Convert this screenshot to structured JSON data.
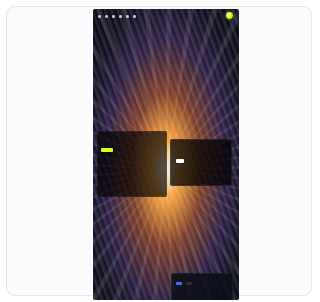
{
  "app": {
    "name": "",
    "accent_color": "#d7ff1a"
  },
  "topbar": {
    "nav_dots_count": 6,
    "brand_text": ""
  },
  "hero": {
    "title": "",
    "copy": "",
    "cta_label": ""
  },
  "center_overlay": {
    "label": ""
  },
  "panel": {
    "title": "",
    "description": "",
    "button_label": ""
  },
  "cookie": {
    "text": "",
    "link_label": "",
    "primary_button": "",
    "secondary_button": ""
  },
  "colors": {
    "frame_bg": "#fafbfc",
    "frame_border": "#e3e7ee",
    "hero_cta_bg": "#d7ff1a",
    "cookie_primary": "#3a6fff",
    "link": "#4aa3ff"
  }
}
